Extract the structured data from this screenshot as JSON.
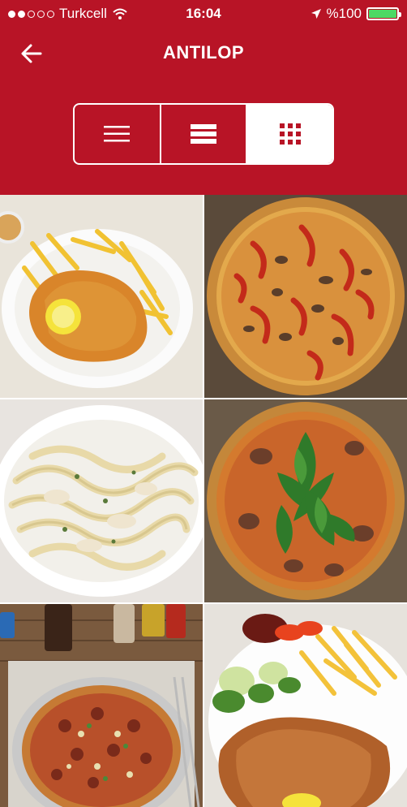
{
  "status_bar": {
    "carrier": "Turkcell",
    "time": "16:04",
    "battery": "%100",
    "battery_level": 1.0,
    "signal_bars_filled": 2,
    "signal_bars_total": 5
  },
  "nav": {
    "title": "ANTILOP",
    "back_icon": "arrow-left-icon"
  },
  "view_switcher": {
    "options": [
      "list-view-icon",
      "detailed-list-view-icon",
      "grid-view-icon"
    ],
    "selected": "grid-view-icon"
  },
  "colors": {
    "brand": "#b81426",
    "battery_fill": "#4cd964"
  },
  "gallery": {
    "items": [
      {
        "subject": "schnitzel-with-fries"
      },
      {
        "subject": "pizza-with-peppers-mushrooms"
      },
      {
        "subject": "fettuccine-chicken-pasta"
      },
      {
        "subject": "pizza-with-arugula"
      },
      {
        "subject": "pizza-on-table"
      },
      {
        "subject": "schnitzel-with-salad"
      }
    ]
  }
}
